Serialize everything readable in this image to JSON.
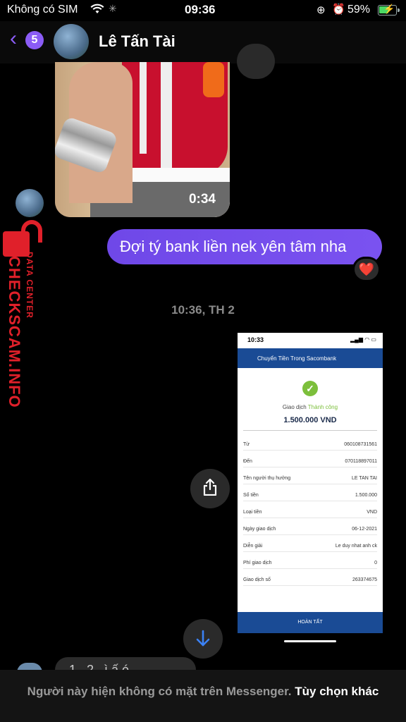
{
  "status_bar": {
    "carrier": "Không có SIM",
    "time": "09:36",
    "battery_percent": "59%",
    "battery_level": 0.59,
    "icons": [
      "wifi-icon",
      "loading-spinner-icon",
      "rotation-lock-icon",
      "alarm-icon",
      "battery-charging-icon"
    ]
  },
  "header": {
    "back_badge_count": "5",
    "contact_name": "Lê Tấn Tài"
  },
  "video_message": {
    "duration": "0:34"
  },
  "outgoing_message": {
    "text": "Đợi tý bank liền nek yên tâm nha",
    "reaction": "❤️"
  },
  "timestamp": "10:36, TH 2",
  "receipt_image": {
    "status_time": "10:33",
    "header_title": "Chuyển Tiền Trong Sacombank",
    "status_prefix": "Giao dịch",
    "status_value": "Thành công",
    "amount": "1.500.000 VND",
    "rows": [
      {
        "label": "Từ",
        "value": "060108731561"
      },
      {
        "label": "Đến",
        "value": "070118897011"
      },
      {
        "label": "Tên người thụ hưởng",
        "value": "LE TAN TAI"
      },
      {
        "label": "Số tiền",
        "value": "1.500.000"
      },
      {
        "label": "Loại tiền",
        "value": "VND"
      },
      {
        "label": "Ngày giao dịch",
        "value": "06-12-2021"
      },
      {
        "label": "Diễn giải",
        "value": "Le duy nhat anh ck"
      },
      {
        "label": "Phí giao dịch",
        "value": "0"
      },
      {
        "label": "Giao dịch số",
        "value": "263374675"
      }
    ],
    "footer_button": "HOÀN TẤT"
  },
  "watermark": {
    "line1": "CHECKSCAM.INFO",
    "line2": "DATA CENTER"
  },
  "partial_incoming_text": "1 . 2 . ì ấ ó",
  "bottom_notice": {
    "text": "Người này hiện không có mặt trên Messenger.",
    "option": "Tùy chọn khác"
  },
  "colors": {
    "accent": "#8b5cf6",
    "outgoing_bubble": "#7a52f0",
    "bank_blue": "#1a4b95",
    "success_green": "#7cbf3b",
    "watermark_red": "#e0202a"
  }
}
